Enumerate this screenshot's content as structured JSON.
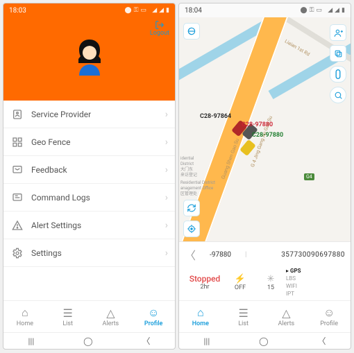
{
  "left": {
    "statusbar": {
      "time": "18:03"
    },
    "logout_label": "Logout",
    "menu": [
      {
        "label": "Service Provider"
      },
      {
        "label": "Geo Fence"
      },
      {
        "label": "Feedback"
      },
      {
        "label": "Command Logs"
      },
      {
        "label": "Alert Settings"
      },
      {
        "label": "Settings"
      }
    ],
    "nav": {
      "home": "Home",
      "list": "List",
      "alerts": "Alerts",
      "profile": "Profile"
    }
  },
  "right": {
    "statusbar": {
      "time": "18:04"
    },
    "vehicles": {
      "a": "C28-97864",
      "b": "C28-97880",
      "c": "C28-97880"
    },
    "roads": {
      "liaian": "Liaian 1st Rd",
      "gse": "Guang Shen Gao Su",
      "jg": "G 4 Jing Gang Ao Gao Su"
    },
    "poi": {
      "l1": "idential",
      "l2": "District",
      "l3": "大门东",
      "l4": "来访登记",
      "l5": "Residential District",
      "l6": "anagement Office",
      "l7": "区管理处"
    },
    "marker": "G4",
    "info": {
      "device_short": "-97880",
      "device_long": "357730090697880",
      "status": "Stopped",
      "status_time": "2hr",
      "acc": "OFF",
      "sat": "15",
      "modes": {
        "gps": "GPS",
        "lbs": "LBS",
        "wifi": "WIFI",
        "ipt": "IPT"
      }
    },
    "nav": {
      "home": "Home",
      "list": "List",
      "alerts": "Alerts",
      "profile": "Profile"
    }
  }
}
